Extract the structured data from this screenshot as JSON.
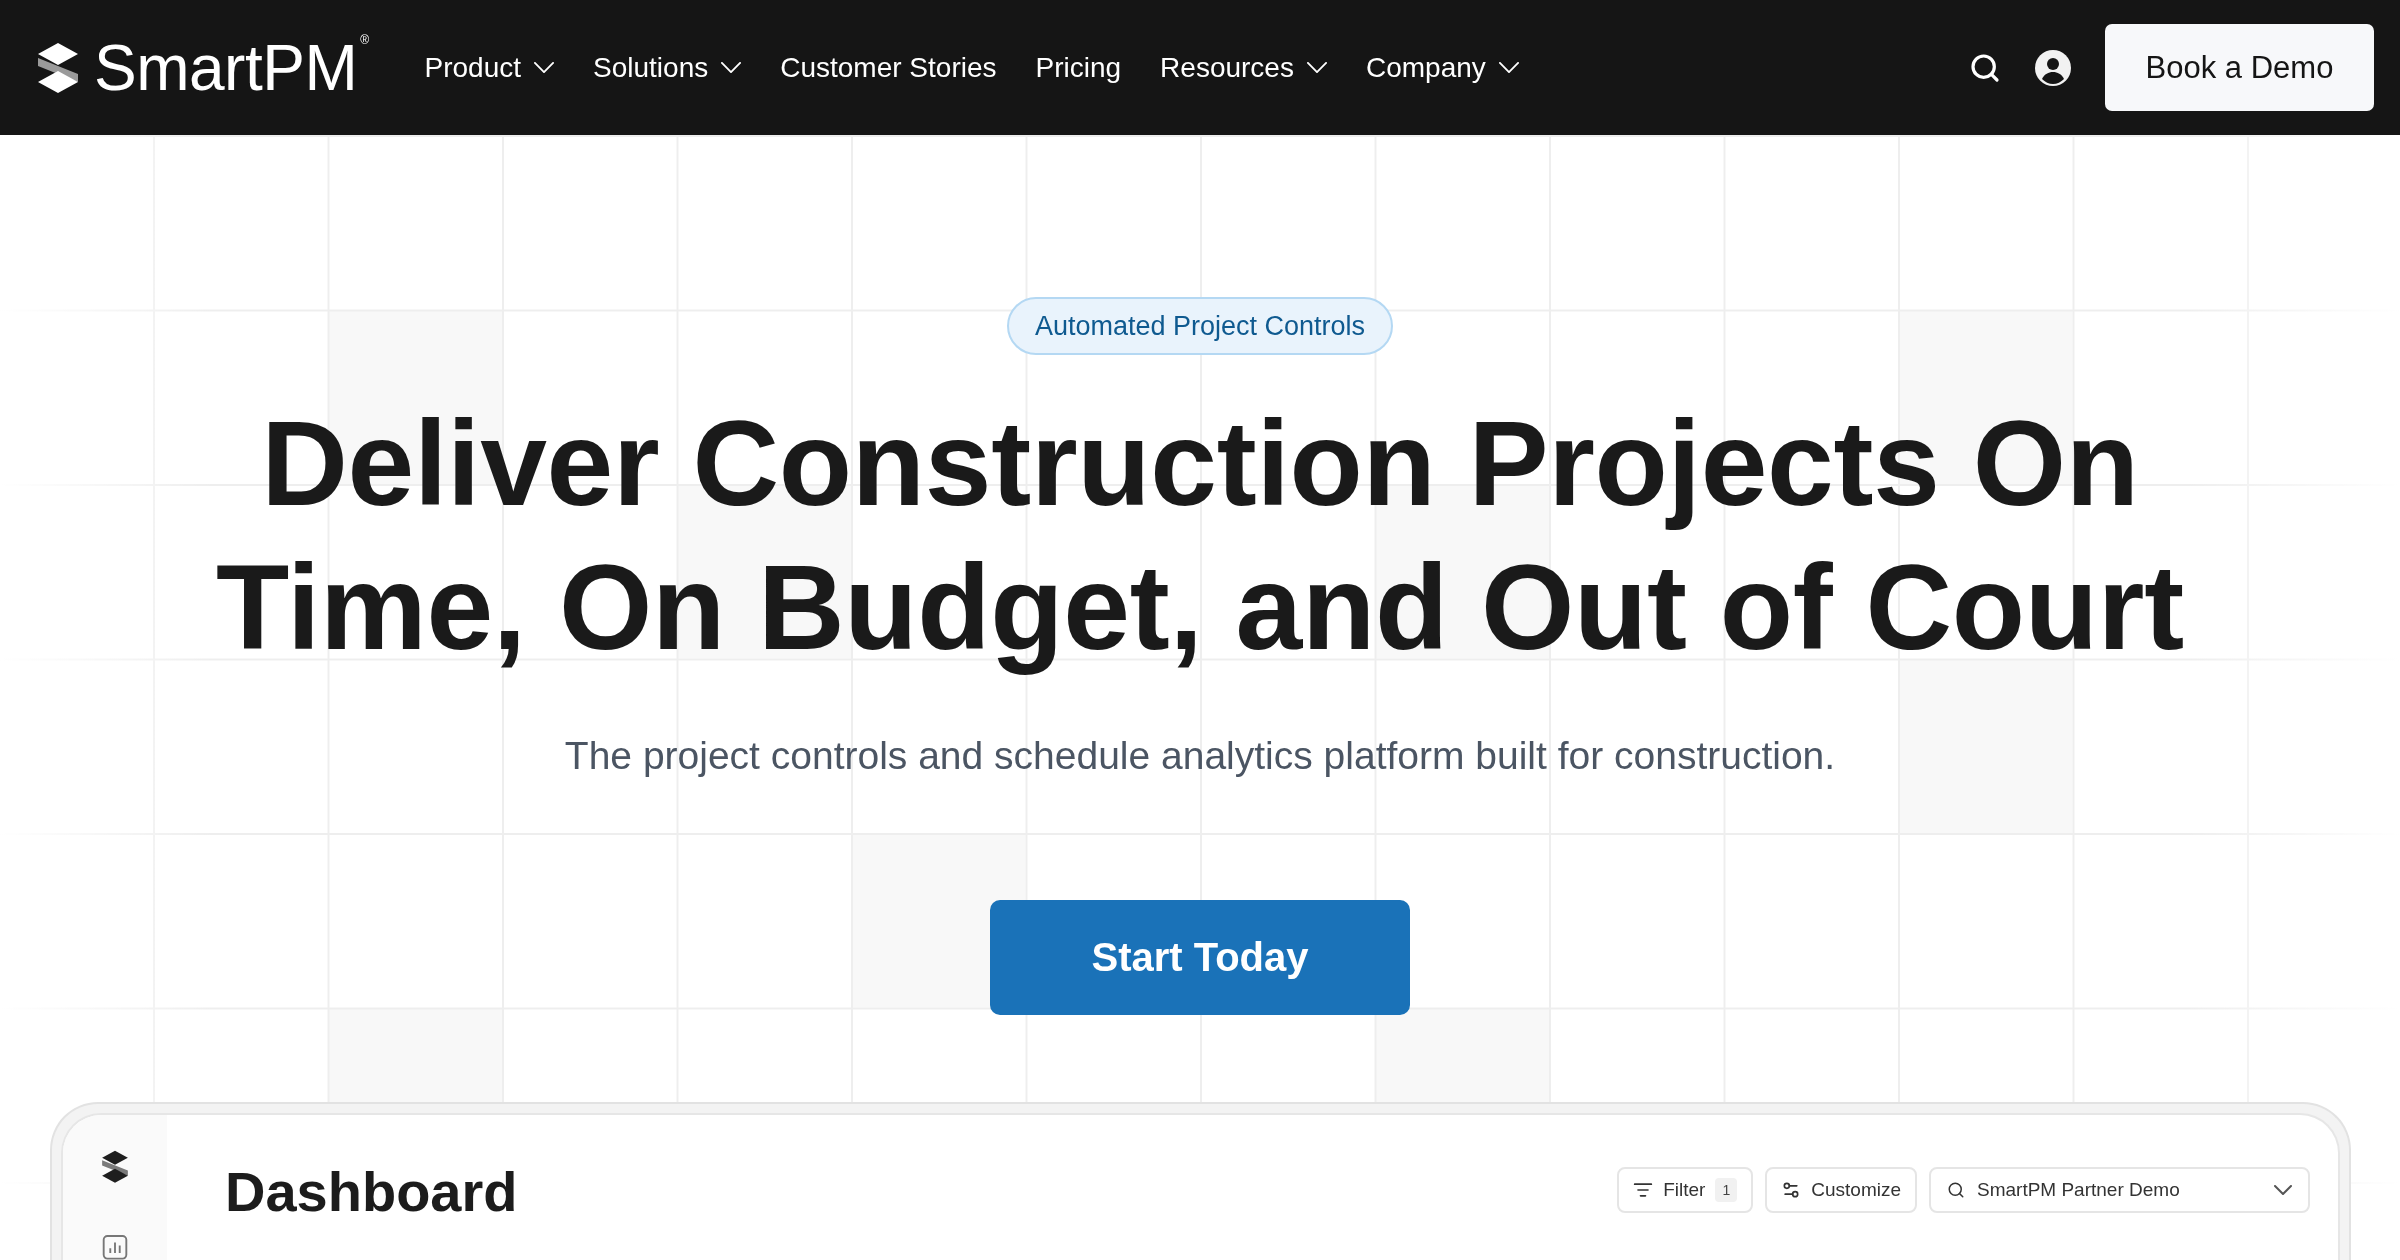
{
  "navbar": {
    "logo": "SmartPM$^{®}$",
    "links": [
      {
        "label": "Product",
        "dropdown": true
      },
      {
        "label": "Solutions",
        "dropdown": true
      },
      {
        "label": "Customer Stories",
        "dropdown": false
      },
      {
        "label": "Pricing",
        "dropdown": false
      },
      {
        "label": "Resources",
        "dropdown": true
      },
      {
        "label": "Company",
        "dropdown": true
      }
    ],
    "cta": "Book a Demo"
  },
  "hero": {
    "badge": "Automated Project Controls",
    "title": "Deliver Construction Projects On Time, On Budget, and Out of Court",
    "subtitle": "The project controls and schedule analytics platform built for construction.",
    "button": "Start Today"
  },
  "dashboard_preview": {
    "title": "Dashboard",
    "filter": {
      "label": "Filter",
      "count": "1"
    },
    "customize": "Customize",
    "project_select": {
      "value": "SmartPM Partner Demo"
    }
  }
}
